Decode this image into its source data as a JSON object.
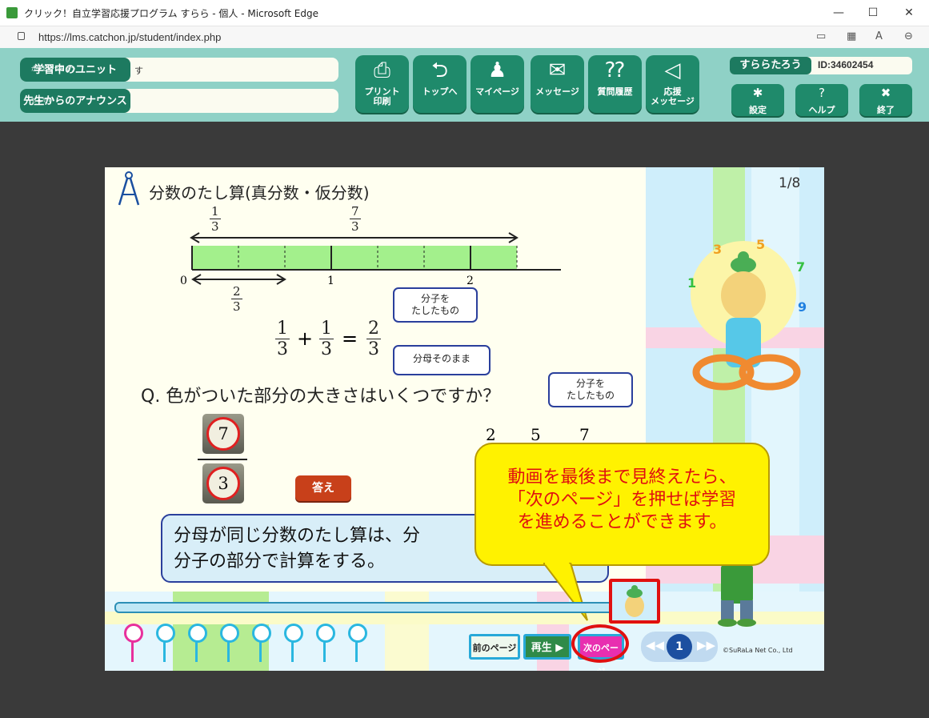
{
  "window": {
    "title": "クリック！自立学習応援プログラム すらら - 個人 - Microsoft Edge",
    "minimize": "—",
    "maximize": "☐",
    "close": "✕"
  },
  "address": {
    "url": "https://lms.catchon.jp/student/index.php"
  },
  "header": {
    "unit_label": "学習中のユニット",
    "unit_ruby": "がくしゅうちゅう",
    "unit_text": "す",
    "announce_label": "先生からのアナウンス",
    "announce_ruby": "せんせい",
    "announce_text": "",
    "nav": [
      {
        "label": "プリント\n印刷",
        "icon": "printer-icon"
      },
      {
        "label": "トップへ",
        "icon": "return-arrow-icon"
      },
      {
        "label": "マイページ",
        "icon": "person-icon"
      },
      {
        "label": "メッセージ",
        "icon": "envelope-icon"
      },
      {
        "label": "質問履歴",
        "icon": "question-chat-icon"
      },
      {
        "label": "応援\nメッセージ",
        "icon": "megaphone-icon"
      }
    ],
    "user_name": "すららたろう",
    "user_id": "ID:34602454",
    "settings_label": "設定",
    "help_label": "ヘルプ",
    "exit_label": "終了"
  },
  "lesson": {
    "title": "分数のたし算(真分数・仮分数)",
    "page": "1/8",
    "numberline": {
      "top_frac_a_n": "1",
      "top_frac_a_d": "3",
      "top_frac_b_n": "7",
      "top_frac_b_d": "3",
      "tick_0": "0",
      "tick_1": "1",
      "tick_2": "2",
      "low_frac_n": "2",
      "low_frac_d": "3"
    },
    "equation": {
      "a_n": "1",
      "a_d": "3",
      "plus": "+",
      "b_n": "1",
      "b_d": "3",
      "eq": "=",
      "c_n": "2",
      "c_d": "3"
    },
    "callout_numerator": "分子を\nたしたもの",
    "callout_denominator": "分母そのまま",
    "callout_numerator_2": "分子を\nたしたもの",
    "question": "Q. 色がついた部分の大きさはいくつですか？",
    "answer_numerator": "7",
    "answer_denominator": "3",
    "answer_button": "答え",
    "partial_values": [
      "2",
      "5",
      "7"
    ],
    "explanation": "分母が同じ分数のたし算は、分\n分子の部分で計算をする。",
    "tooltip": "動画を最後まで見終えたら、\n「次のページ」を押せば学習\nを進めることができます。",
    "controls": {
      "prev": "前のページ",
      "play": "再生",
      "next": "次のページ",
      "page_num": "1",
      "copyright": "©SuRaLa Net Co., Ltd"
    },
    "progress": 0.0
  },
  "colors": {
    "header_bg": "#8fd1c6",
    "button_green": "#1f8a6b",
    "highlight_red": "#e01010",
    "tooltip_yellow": "#fff200"
  }
}
